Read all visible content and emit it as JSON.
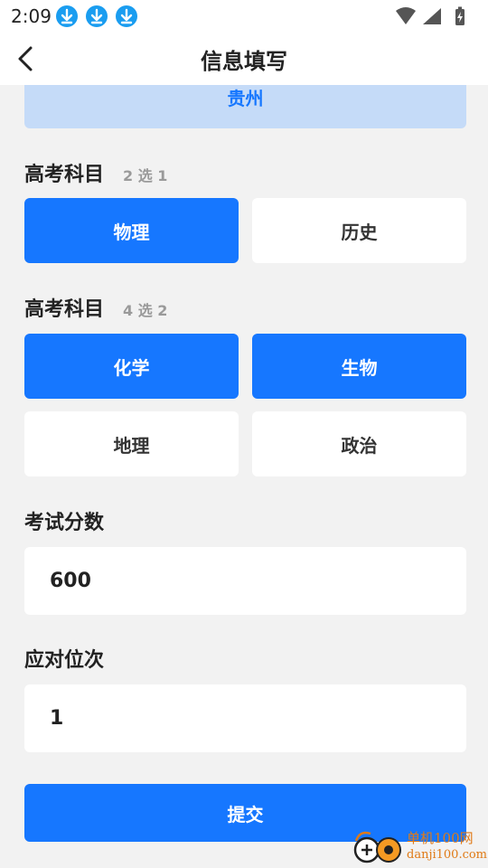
{
  "status_bar": {
    "time": "2:09",
    "notification_icons": [
      "download-icon",
      "download-icon",
      "download-icon"
    ],
    "right_icons": [
      "wifi-icon",
      "signal-icon",
      "battery-icon"
    ]
  },
  "header": {
    "title": "信息填写",
    "back_icon": "chevron-left-icon"
  },
  "province": {
    "value": "贵州"
  },
  "subjects_primary": {
    "title": "高考科目",
    "hint": "2 选 1",
    "options": [
      {
        "label": "物理",
        "selected": true
      },
      {
        "label": "历史",
        "selected": false
      }
    ]
  },
  "subjects_secondary": {
    "title": "高考科目",
    "hint": "4 选 2",
    "options": [
      {
        "label": "化学",
        "selected": true
      },
      {
        "label": "生物",
        "selected": true
      },
      {
        "label": "地理",
        "selected": false
      },
      {
        "label": "政治",
        "selected": false
      }
    ]
  },
  "score": {
    "label": "考试分数",
    "value": "600"
  },
  "rank": {
    "label": "应对位次",
    "value": "1"
  },
  "submit": {
    "label": "提交"
  },
  "watermark": {
    "title": "单机100网",
    "subtitle": "danji100.com"
  },
  "colors": {
    "accent": "#1677ff",
    "province_bg": "#c5dbf8",
    "page_bg": "#f2f2f2",
    "watermark": "#e07a16"
  }
}
